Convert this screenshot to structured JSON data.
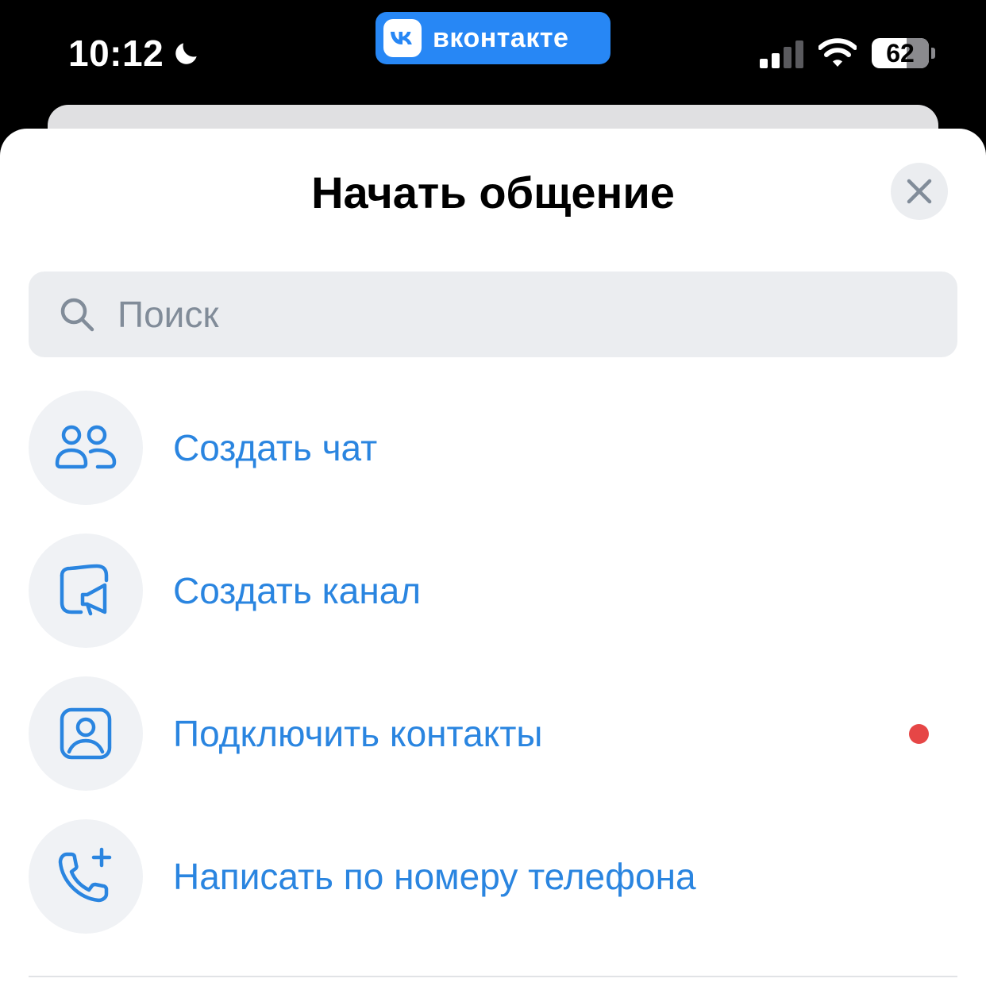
{
  "status_bar": {
    "time": "10:12",
    "moon_icon": "moon-icon",
    "app_badge": {
      "logo_text": "VK",
      "label": "вконтакте",
      "color": "#2787f5"
    },
    "signal_icon": "cellular-signal-icon",
    "wifi_icon": "wifi-icon",
    "battery_level": "62"
  },
  "sheet": {
    "title": "Начать общение",
    "close_icon": "close-icon",
    "search": {
      "placeholder": "Поиск",
      "value": "",
      "icon": "search-icon"
    },
    "items": [
      {
        "label": "Создать чат",
        "icon": "users-icon",
        "badge": false
      },
      {
        "label": "Создать канал",
        "icon": "channel-megaphone-icon",
        "badge": false
      },
      {
        "label": "Подключить контакты",
        "icon": "contact-card-icon",
        "badge": true
      },
      {
        "label": "Написать по номеру телефона",
        "icon": "phone-add-icon",
        "badge": false
      }
    ]
  },
  "colors": {
    "accent": "#2a85e0",
    "icon_background": "#f0f2f5",
    "notification_dot": "#e64646"
  }
}
